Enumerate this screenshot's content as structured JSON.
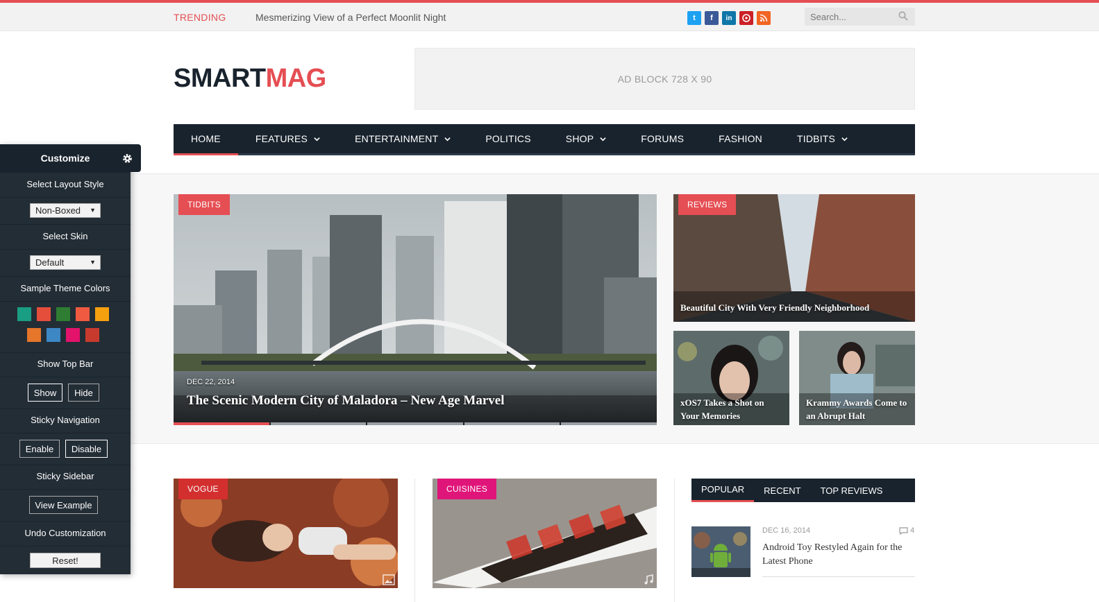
{
  "topbar": {
    "trending_label": "TRENDING",
    "trending_text": "Mesmerizing View of a Perfect Moonlit Night",
    "socials": [
      {
        "icon": "twitter-icon",
        "glyph": "t",
        "color": "#1da1f2"
      },
      {
        "icon": "facebook-icon",
        "glyph": "f",
        "color": "#3b5998"
      },
      {
        "icon": "linkedin-icon",
        "glyph": "in",
        "color": "#0e76a8"
      },
      {
        "icon": "pinterest-icon",
        "glyph": "p",
        "color": "#cb2027"
      },
      {
        "icon": "rss-icon",
        "glyph": "))",
        "color": "#f26522"
      }
    ],
    "search_placeholder": "Search..."
  },
  "header": {
    "logo_part1": "SMART",
    "logo_part2": "MAG",
    "ad_text": "AD BLOCK  728 X 90"
  },
  "nav": {
    "items": [
      {
        "label": "HOME",
        "dropdown": false
      },
      {
        "label": "FEATURES",
        "dropdown": true
      },
      {
        "label": "ENTERTAINMENT",
        "dropdown": true
      },
      {
        "label": "POLITICS",
        "dropdown": false
      },
      {
        "label": "SHOP",
        "dropdown": true
      },
      {
        "label": "FORUMS",
        "dropdown": false
      },
      {
        "label": "FASHION",
        "dropdown": false
      },
      {
        "label": "TIDBITS",
        "dropdown": true
      }
    ]
  },
  "featured": {
    "main": {
      "category": "TIDBITS",
      "date": "DEC 22, 2014",
      "title": "The Scenic Modern City of Maladora – New Age Marvel"
    },
    "side_top": {
      "category": "REVIEWS",
      "title": "Beautiful City With Very Friendly Neighborhood"
    },
    "side_left": {
      "title": "xOS7 Takes a Shot on Your Memories"
    },
    "side_right": {
      "title": "Krammy Awards Come to an Abrupt Halt"
    }
  },
  "cards": [
    {
      "category": "VOGUE",
      "category_color": "#d32f2f"
    },
    {
      "category": "CUISINES",
      "category_color": "#e0157a"
    }
  ],
  "sidebar_widget": {
    "tabs": [
      "POPULAR",
      "RECENT",
      "TOP REVIEWS"
    ],
    "post": {
      "date": "DEC 16, 2014",
      "comments": "4",
      "title": "Android Toy Restyled Again for the Latest Phone"
    }
  },
  "customize": {
    "title": "Customize",
    "layout_label": "Select Layout Style",
    "layout_value": "Non-Boxed",
    "skin_label": "Select Skin",
    "skin_value": "Default",
    "colors_label": "Sample Theme Colors",
    "colors_row1": [
      "#1a9e83",
      "#e54e3b",
      "#2e7d32",
      "#ef5a41",
      "#f5a00f"
    ],
    "colors_row2": [
      "#e5762a",
      "#3d87c4",
      "#e3136b",
      "#c93a2e"
    ],
    "topbar_label": "Show Top Bar",
    "topbar_show": "Show",
    "topbar_hide": "Hide",
    "sticky_nav_label": "Sticky Navigation",
    "sticky_nav_enable": "Enable",
    "sticky_nav_disable": "Disable",
    "sticky_sidebar_label": "Sticky Sidebar",
    "view_example": "View Example",
    "undo_label": "Undo Customization",
    "reset": "Reset!"
  }
}
